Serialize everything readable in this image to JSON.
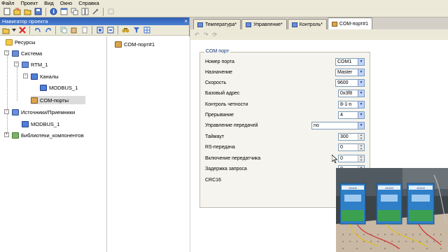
{
  "menu": [
    "Файл",
    "Проект",
    "Вид",
    "Окно",
    "Справка"
  ],
  "navigator": {
    "title": "Навигатор проекта",
    "close": "×",
    "tree": [
      {
        "label": "Ресурсы",
        "icon": "folder-icon"
      },
      {
        "label": "Система",
        "icon": "computer-icon"
      },
      {
        "label": "RTM_1",
        "icon": "computer-icon"
      },
      {
        "label": "Каналы",
        "icon": "channels-icon"
      },
      {
        "label": "MODBUS_1",
        "icon": "device-icon"
      },
      {
        "label": "COM-порты",
        "icon": "com-port-icon"
      },
      {
        "label": "Источники/Приемники",
        "icon": "computer-icon"
      },
      {
        "label": "MODBUS_1",
        "icon": "device-icon"
      },
      {
        "label": "Библиотеки_компонентов",
        "icon": "library-icon"
      }
    ],
    "list_item": "COM-порт#1"
  },
  "tabs": [
    {
      "label": "Температура*"
    },
    {
      "label": "Управление*"
    },
    {
      "label": "Контроль*"
    },
    {
      "label": "COM-порт#1"
    }
  ],
  "com_port": {
    "group_title": "COM порт",
    "rows": [
      {
        "label": "Номер порта",
        "value": "COM1"
      },
      {
        "label": "Назначение",
        "value": "Master"
      },
      {
        "label": "Скорость",
        "value": "9600"
      },
      {
        "label": "Базовый адрес",
        "value": "0x3f8"
      },
      {
        "label": "Контроль четности",
        "value": "8-1-n"
      },
      {
        "label": "Прерывание",
        "value": "4"
      },
      {
        "label": "Управление передачей",
        "value": "no"
      },
      {
        "label": "Таймаут",
        "value": "300"
      },
      {
        "label": "RS-передача",
        "value": "0"
      },
      {
        "label": "Включение передатчика",
        "value": "0"
      },
      {
        "label": "Задержка запроса",
        "value": "0"
      },
      {
        "label": "CRC16",
        "value": ""
      }
    ]
  },
  "photo": {
    "modules": [
      "ADAM",
      "ADAM",
      "ADAM"
    ]
  }
}
